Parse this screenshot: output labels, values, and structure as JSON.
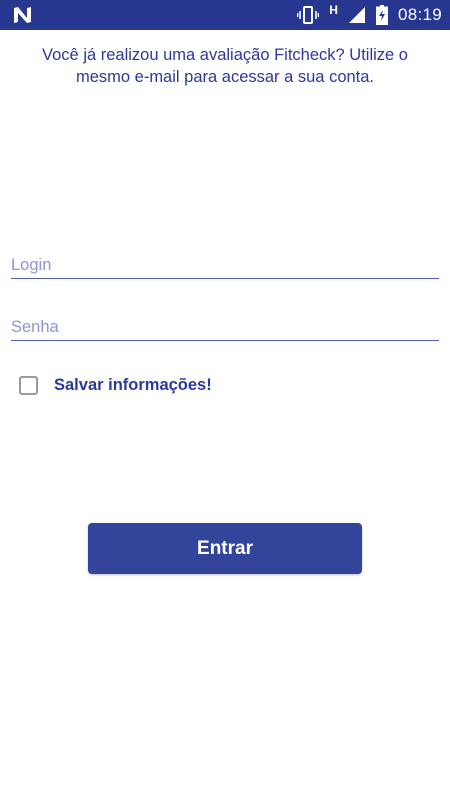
{
  "status_bar": {
    "time": "08:19",
    "network_type": "H",
    "icons": [
      "notification-n-icon",
      "vibrate-icon",
      "signal-icon",
      "battery-icon"
    ],
    "background_color": "#27378f"
  },
  "intro": {
    "text": "Você já realizou uma avaliação Fitcheck? Utilize o mesmo e-mail para acessar a sua conta."
  },
  "form": {
    "login_placeholder": "Login",
    "password_placeholder": "Senha",
    "remember_label": "Salvar informações!",
    "remember_checked": false
  },
  "actions": {
    "submit_label": "Entrar",
    "button_color": "#33449b"
  }
}
